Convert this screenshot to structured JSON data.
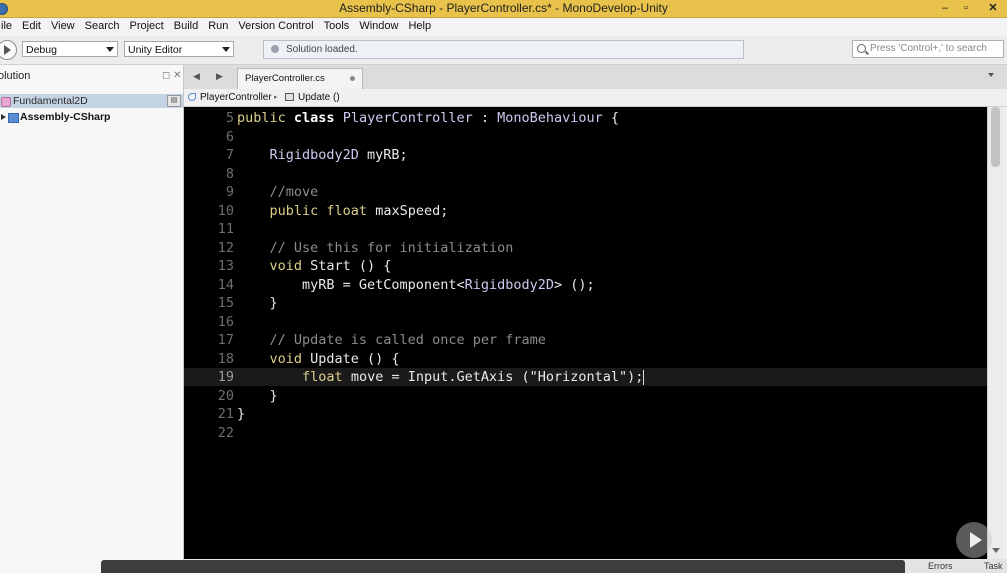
{
  "window": {
    "title": "Assembly-CSharp - PlayerController.cs* - MonoDevelop-Unity",
    "controls": {
      "minimize": "–",
      "maximize": "▫",
      "close": "✕"
    }
  },
  "menu": [
    "ile",
    "Edit",
    "View",
    "Search",
    "Project",
    "Build",
    "Run",
    "Version Control",
    "Tools",
    "Window",
    "Help"
  ],
  "toolbar": {
    "config": "Debug",
    "target": "Unity Editor",
    "status": "Solution loaded.",
    "search_placeholder": "Press 'Control+,' to search"
  },
  "solution_pad": {
    "title": "olution",
    "controls": "◻ ✕",
    "solution_name": "Fundamental2D",
    "solution_opt": "▤",
    "project_name": "Assembly-CSharp"
  },
  "tabs": [
    {
      "label": "PlayerController.cs",
      "active": true
    }
  ],
  "breadcrumb": {
    "class": "PlayerController",
    "sep": "▸",
    "method": "Update ()"
  },
  "editor": {
    "current_line": 19,
    "lines": [
      {
        "n": "5",
        "tokens": [
          [
            "kw2",
            "public "
          ],
          [
            "kw",
            "class "
          ],
          [
            "type",
            "PlayerController"
          ],
          [
            "id",
            " : "
          ],
          [
            "type",
            "MonoBehaviour"
          ],
          [
            "id",
            " {"
          ]
        ]
      },
      {
        "n": "6",
        "tokens": []
      },
      {
        "n": "7",
        "tokens": [
          [
            "id",
            "    "
          ],
          [
            "type",
            "Rigidbody2D"
          ],
          [
            "id",
            " myRB;"
          ]
        ]
      },
      {
        "n": "8",
        "tokens": []
      },
      {
        "n": "9",
        "tokens": [
          [
            "com",
            "    //move"
          ]
        ]
      },
      {
        "n": "10",
        "tokens": [
          [
            "id",
            "    "
          ],
          [
            "kw2",
            "public "
          ],
          [
            "kw2",
            "float "
          ],
          [
            "id",
            "maxSpeed;"
          ]
        ]
      },
      {
        "n": "11",
        "tokens": []
      },
      {
        "n": "12",
        "tokens": [
          [
            "com",
            "    // Use this for initialization"
          ]
        ]
      },
      {
        "n": "13",
        "tokens": [
          [
            "id",
            "    "
          ],
          [
            "kw2",
            "void "
          ],
          [
            "id",
            "Start () {"
          ]
        ]
      },
      {
        "n": "14",
        "tokens": [
          [
            "id",
            "        myRB = GetComponent<"
          ],
          [
            "type",
            "Rigidbody2D"
          ],
          [
            "id",
            "> ();"
          ]
        ]
      },
      {
        "n": "15",
        "tokens": [
          [
            "id",
            "    }"
          ]
        ]
      },
      {
        "n": "16",
        "tokens": []
      },
      {
        "n": "17",
        "tokens": [
          [
            "com",
            "    // Update is called once per frame"
          ]
        ]
      },
      {
        "n": "18",
        "tokens": [
          [
            "id",
            "    "
          ],
          [
            "kw2",
            "void "
          ],
          [
            "id",
            "Update () {"
          ]
        ]
      },
      {
        "n": "19",
        "tokens": [
          [
            "id",
            "        "
          ],
          [
            "kw2",
            "float "
          ],
          [
            "id",
            "move = Input.GetAxis ("
          ],
          [
            "str",
            "\"Horizontal\""
          ],
          [
            "id",
            ");"
          ]
        ]
      },
      {
        "n": "20",
        "tokens": [
          [
            "id",
            "    }"
          ]
        ]
      },
      {
        "n": "21",
        "tokens": [
          [
            "id",
            "}"
          ]
        ]
      },
      {
        "n": "22",
        "tokens": []
      }
    ]
  },
  "bottom": {
    "errors": "Errors",
    "tasks": "Task"
  },
  "colors": {
    "title_bar": "#e8c24a",
    "editor_bg": "#000000",
    "selection": "#c5d4e4"
  },
  "icons": [
    "run-icon",
    "status-icon",
    "search-icon",
    "solution-icon",
    "project-icon",
    "class-icon",
    "method-icon",
    "play-icon"
  ]
}
